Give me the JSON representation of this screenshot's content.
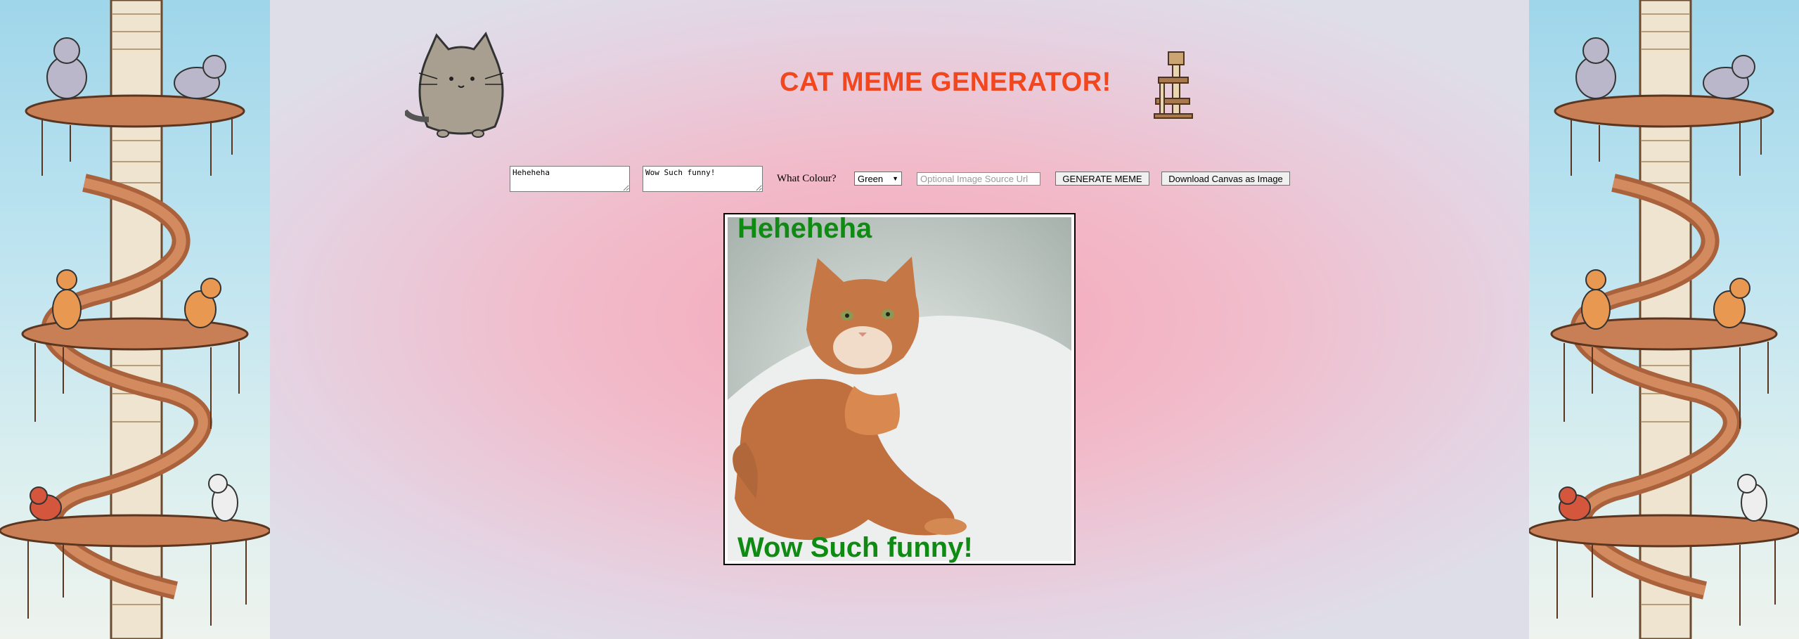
{
  "header": {
    "title": "CAT MEME GENERATOR!"
  },
  "controls": {
    "top_text": "Heheheha",
    "bottom_text": "Wow Such funny!",
    "colour_label": "What Colour?",
    "colour_selected": "Green",
    "url_placeholder": "Optional Image Source Url",
    "generate_label": "GENERATE MEME",
    "download_label": "Download Canvas as Image"
  },
  "meme": {
    "top_text": "Heheheha",
    "bottom_text": "Wow Such funny!",
    "text_color": "#0f8a13"
  },
  "colors": {
    "title": "#f1461e",
    "page_center": "#f6a6b8",
    "page_edge": "#dedee9",
    "side_sky": "#9fd6ea"
  },
  "icons": [
    "pusheen-cat-icon",
    "cat-tower-icon",
    "cat-tree-illustration"
  ]
}
